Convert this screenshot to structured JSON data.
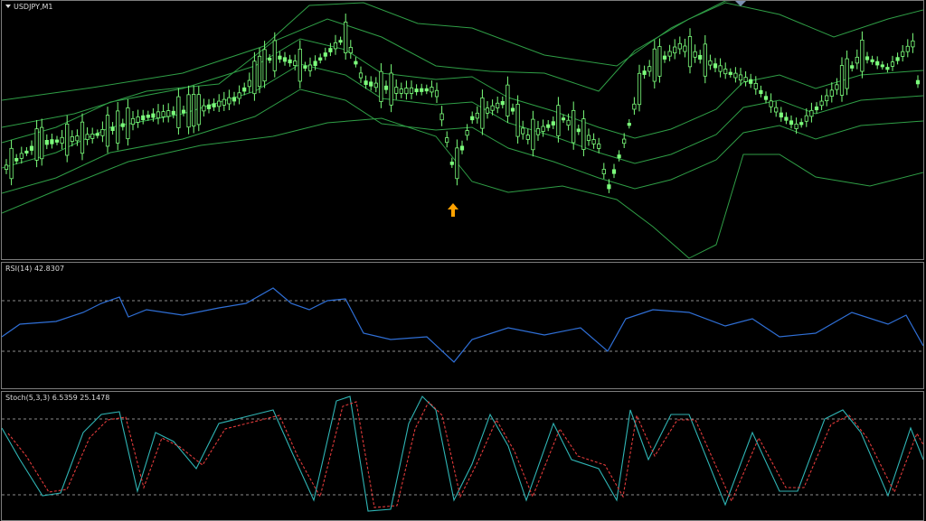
{
  "main": {
    "symbol_label": "USDJPY,M1",
    "menu_icon": "triangle-down-icon",
    "signal_icon": "up-arrow-icon",
    "colors": {
      "candles": "#7cff7c",
      "bands": "#2f9e46",
      "arrow": "#ffa200",
      "background": "#000000"
    }
  },
  "rsi": {
    "label": "RSI(14) 42.8307",
    "colors": {
      "line": "#2f6fd6",
      "levels": "#8c8c8c"
    }
  },
  "stoch": {
    "label": "Stoch(5,3,3) 6.5359 25.1478",
    "colors": {
      "main": "#2fb5b5",
      "signal": "#e03a3a",
      "levels": "#8c8c8c"
    }
  }
}
